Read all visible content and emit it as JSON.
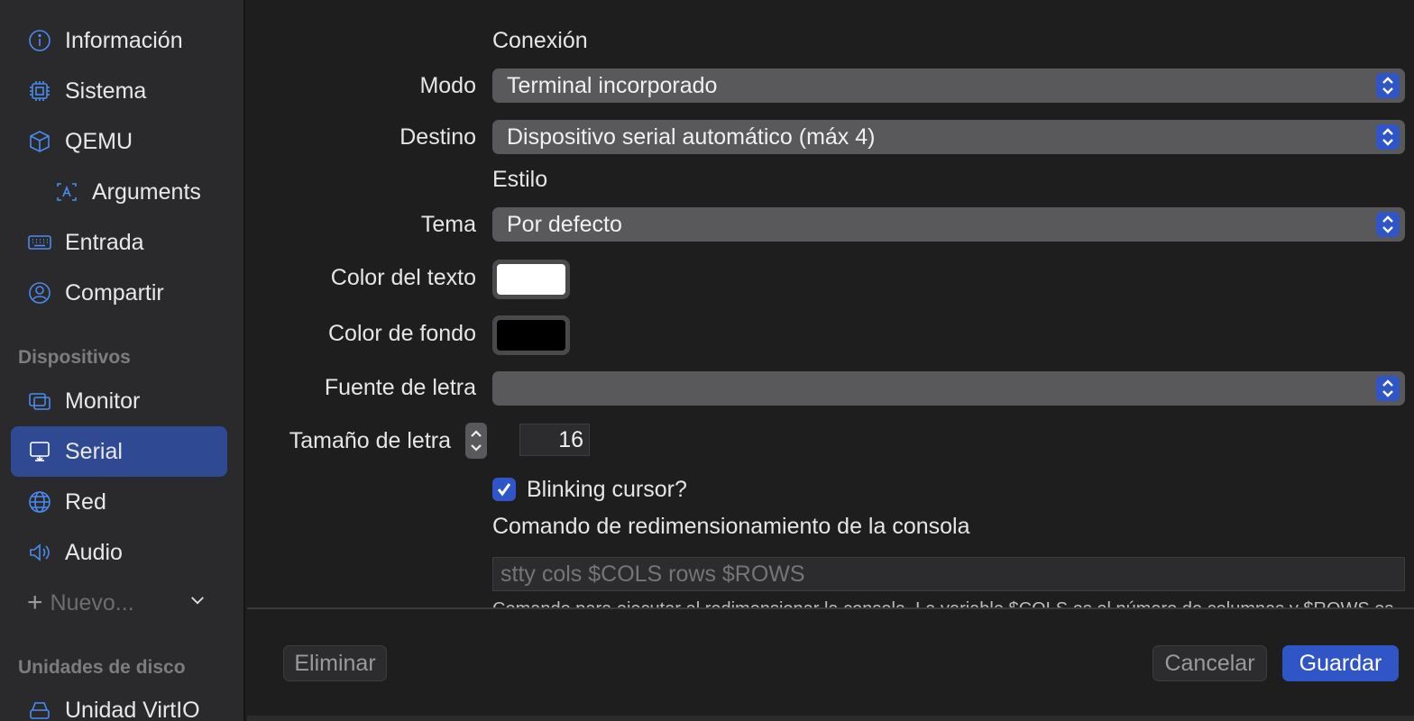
{
  "sidebar": {
    "items": [
      {
        "label": "Información",
        "icon": "info-icon"
      },
      {
        "label": "Sistema",
        "icon": "chip-icon"
      },
      {
        "label": "QEMU",
        "icon": "cube-icon"
      },
      {
        "label": "Arguments",
        "icon": "text-box-icon"
      },
      {
        "label": "Entrada",
        "icon": "keyboard-icon"
      },
      {
        "label": "Compartir",
        "icon": "person-circle-icon"
      }
    ],
    "devices_header": "Dispositivos",
    "devices": [
      {
        "label": "Monitor",
        "icon": "display-icon"
      },
      {
        "label": "Serial",
        "icon": "serial-icon",
        "selected": true
      },
      {
        "label": "Red",
        "icon": "globe-icon"
      },
      {
        "label": "Audio",
        "icon": "speaker-icon"
      }
    ],
    "new_label": "Nuevo...",
    "drives_header": "Unidades de disco",
    "drives": [
      {
        "label": "Unidad VirtIO",
        "icon": "drive-icon"
      }
    ]
  },
  "form": {
    "connection_title": "Conexión",
    "mode_label": "Modo",
    "mode_value": "Terminal incorporado",
    "target_label": "Destino",
    "target_value": "Dispositivo serial automático (máx 4)",
    "style_title": "Estilo",
    "theme_label": "Tema",
    "theme_value": "Por defecto",
    "text_color_label": "Color del texto",
    "text_color": "#ffffff",
    "bg_color_label": "Color de fondo",
    "bg_color": "#000000",
    "font_label": "Fuente de letra",
    "font_value": "",
    "font_size_label": "Tamaño de letra",
    "font_size_value": "16",
    "blinking_label": "Blinking cursor?",
    "blinking_checked": true,
    "resize_title": "Comando de redimensionamiento de la consola",
    "resize_placeholder": "stty cols $COLS rows $ROWS",
    "resize_help": "Comando para ejecutar al redimensionar la consola. La variable $COLS es el número de columnas y $ROWS es"
  },
  "footer": {
    "delete_label": "Eliminar",
    "cancel_label": "Cancelar",
    "save_label": "Guardar"
  },
  "colors": {
    "accent": "#2f55c6",
    "selected_bg": "#2f4a92",
    "icon_blue": "#4a8bf0"
  }
}
